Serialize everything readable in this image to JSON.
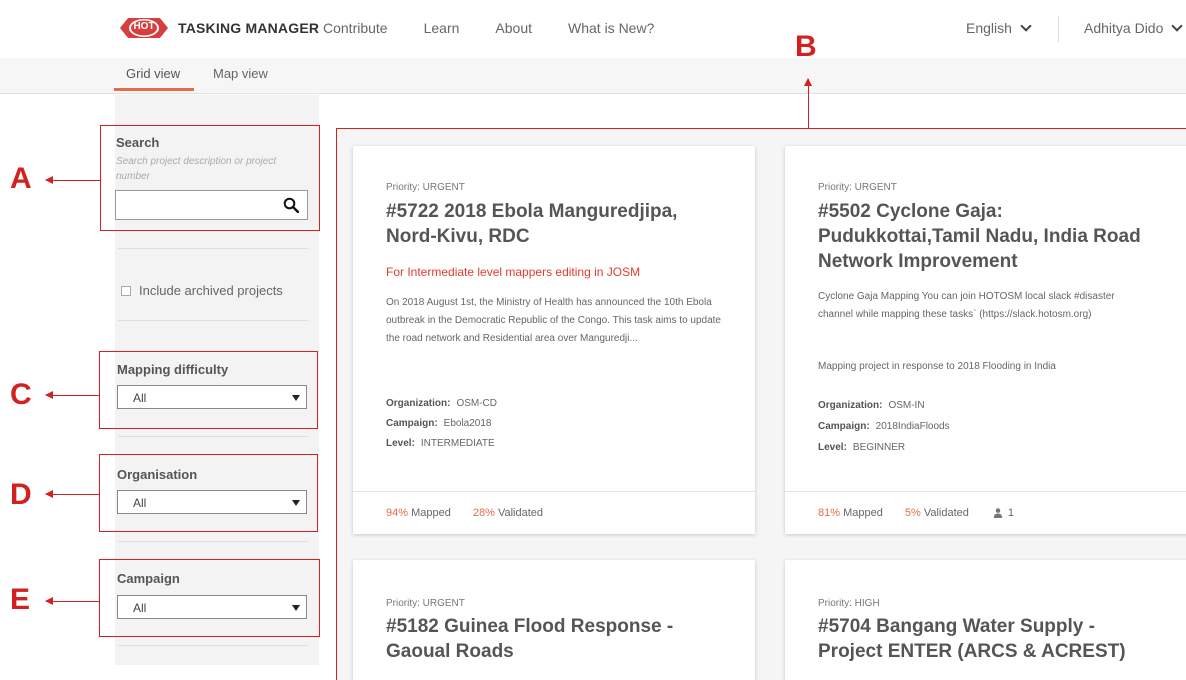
{
  "header": {
    "logo_badge": "HOT",
    "app_title": "TASKING MANAGER",
    "nav": [
      "Contribute",
      "Learn",
      "About",
      "What is New?"
    ],
    "language": "English",
    "user": "Adhitya Dido"
  },
  "tabs": [
    "Grid view",
    "Map view"
  ],
  "annotations": {
    "a": "A",
    "b": "B",
    "c": "C",
    "d": "D",
    "e": "E"
  },
  "sidebar": {
    "search_label": "Search",
    "search_hint": "Search project description or project number",
    "search_value": "",
    "archived_label": "Include archived projects",
    "difficulty_label": "Mapping difficulty",
    "difficulty_value": "All",
    "organisation_label": "Organisation",
    "organisation_value": "All",
    "campaign_label": "Campaign",
    "campaign_value": "All"
  },
  "cards": [
    {
      "priority": "Priority: URGENT",
      "title": "#5722 2018 Ebola Manguredjipa, Nord-Kivu, RDC",
      "subtitle": "For Intermediate level mappers editing in JOSM",
      "desc": "On 2018 August 1st, the Ministry of Health has announced the 10th Ebola outbreak in the Democratic Republic of the Congo. This task aims to update the road network and Residential area over Manguredji...",
      "desc2": "",
      "org_label": "Organization:",
      "org": "OSM-CD",
      "campaign_label": "Campaign:",
      "campaign": "Ebola2018",
      "level_label": "Level:",
      "level": "INTERMEDIATE",
      "mapped_pct": "94%",
      "mapped_label": "Mapped",
      "validated_pct": "28%",
      "validated_label": "Validated",
      "contributors": ""
    },
    {
      "priority": "Priority: URGENT",
      "title": "#5502 Cyclone Gaja: Pudukkottai,Tamil Nadu, India Road Network Improvement",
      "subtitle": "",
      "desc": "Cyclone Gaja Mapping You can join HOTOSM local slack #disaster channel while mapping these tasks` (https://slack.hotosm.org)",
      "desc2": "Mapping project in response to 2018 Flooding in India",
      "org_label": "Organization:",
      "org": "OSM-IN",
      "campaign_label": "Campaign:",
      "campaign": "2018IndiaFloods",
      "level_label": "Level:",
      "level": "BEGINNER",
      "mapped_pct": "81%",
      "mapped_label": "Mapped",
      "validated_pct": "5%",
      "validated_label": "Validated",
      "contributors": "1"
    },
    {
      "priority": "Priority: URGENT",
      "title": "#5182 Guinea Flood Response - Gaoual Roads"
    },
    {
      "priority": "Priority: HIGH",
      "title": "#5704 Bangang Water Supply - Project ENTER (ARCS & ACREST)"
    }
  ]
}
